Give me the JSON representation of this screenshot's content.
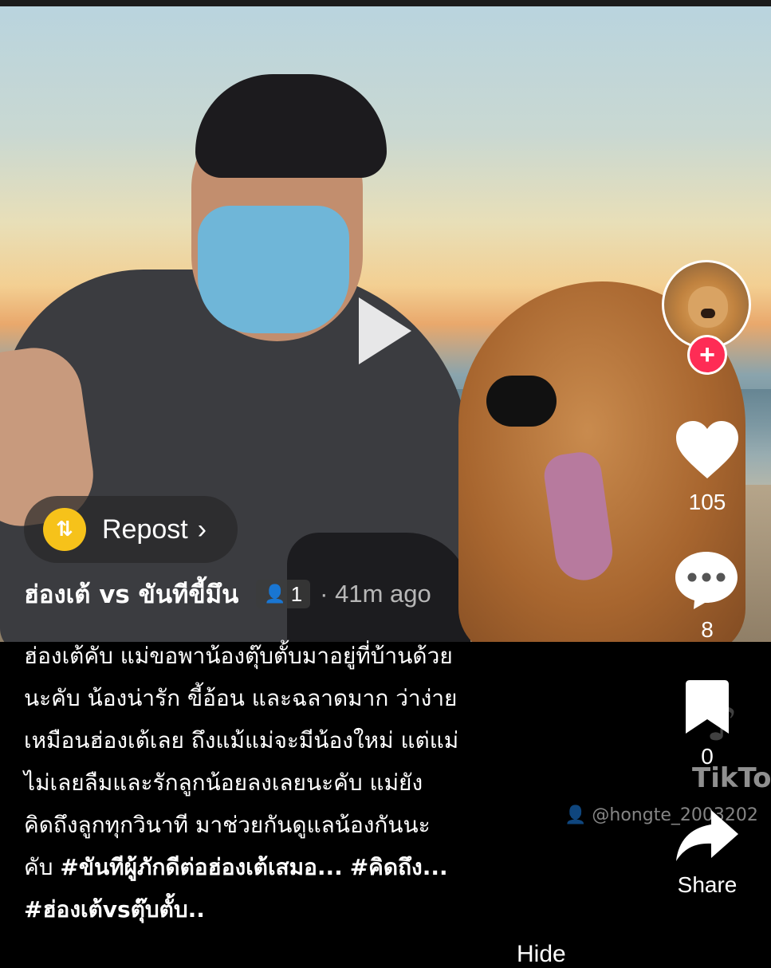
{
  "video": {
    "repost_label": "Repost",
    "repost_chevron": "›",
    "username": "ฮ่องเต้ vs ขันทีขี้มึน",
    "friends_count": "1",
    "time_ago": "· 41m ago",
    "watermark_text": "TikTok",
    "watermark_handle": "@hongte_2003202"
  },
  "caption": {
    "lines": [
      "ฮ่องเต้คับ แม่ขอพาน้องตุ๊บตั้บมาอยู่ที่บ้านด้วย",
      "นะคับ น้องน่ารัก ขี้อ้อน และฉลาดมาก ว่าง่าย",
      "เหมือนฮ่องเต้เลย ถึงแม้แม่จะมีน้องใหม่ แต่แม่",
      "ไม่เลยลืมและรักลูกน้อยลงเลยนะคับ แม่ยัง",
      "คิดถึงลูกทุกวินาที มาช่วยกันดูแลน้องกันนะ"
    ],
    "line6_text": "คับ ",
    "hashtag1": "#ขันทีผู้ภักดีต่อฮ่องเต้เสมอ...",
    "hashtag2": "#คิดถึง...",
    "hashtag3": "#ฮ่องเต้vsตุ๊บตั้บ..",
    "hide_stub": "Hide"
  },
  "actions": {
    "like_count": "105",
    "comment_count": "8",
    "favorite_count": "0",
    "share_label": "Share",
    "follow_symbol": "+"
  },
  "colors": {
    "follow_red": "#fe2c55",
    "repost_yellow": "#f6c21a",
    "background": "#000000"
  },
  "icons": [
    "play-icon",
    "repost-icon",
    "chevron-right-icon",
    "person-icon",
    "heart-icon",
    "comment-icon",
    "bookmark-icon",
    "share-icon",
    "plus-icon",
    "tiktok-logo-icon"
  ]
}
